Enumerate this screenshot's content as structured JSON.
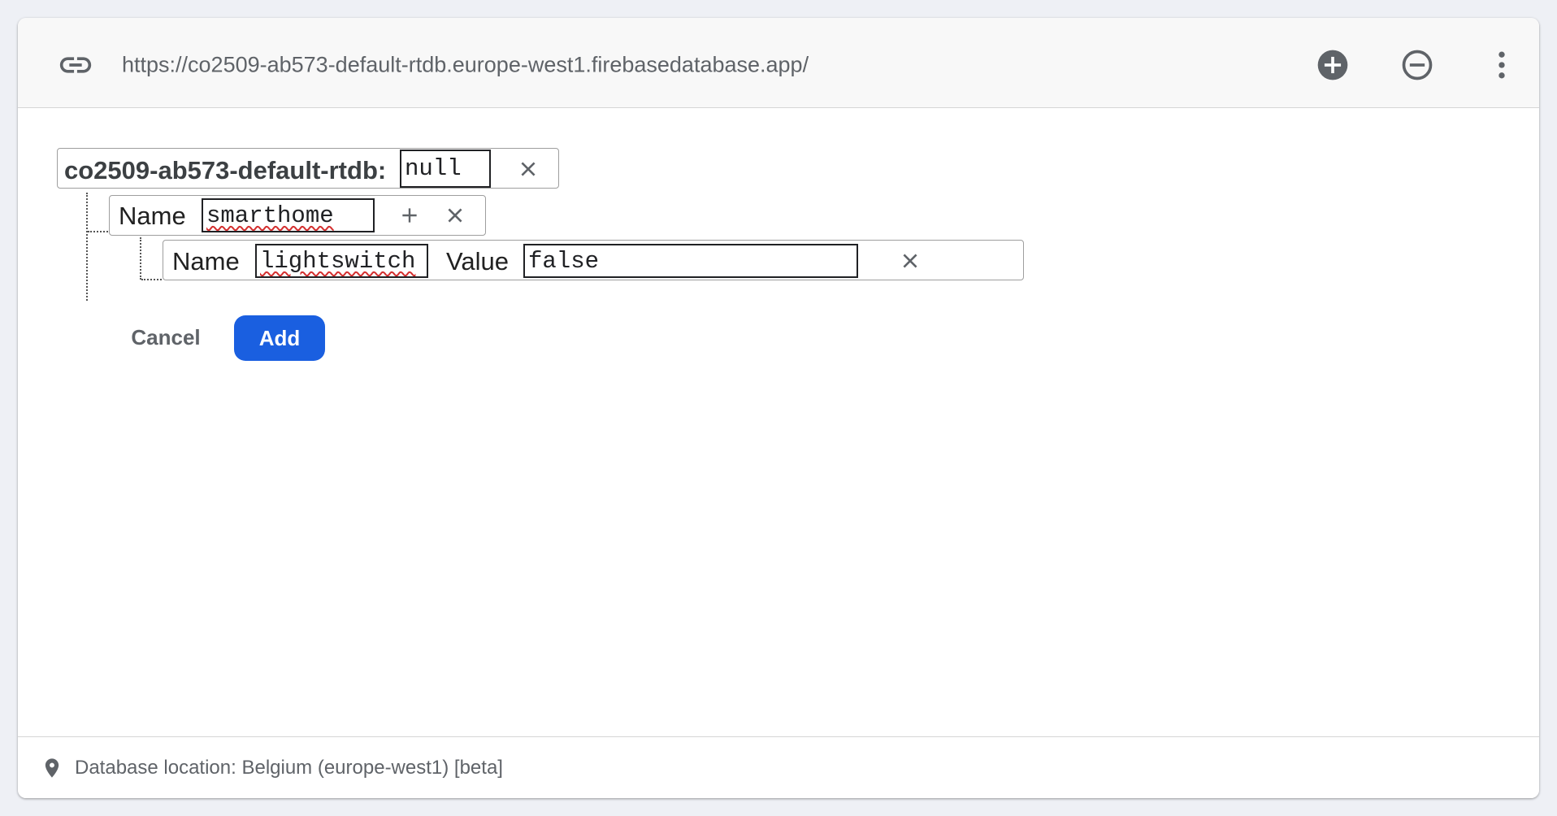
{
  "header": {
    "url": "https://co2509-ab573-default-rtdb.europe-west1.firebasedatabase.app/",
    "link_icon": "link-icon",
    "actions": [
      {
        "name": "add-circle-icon"
      },
      {
        "name": "remove-circle-icon"
      },
      {
        "name": "more-vert-icon"
      }
    ]
  },
  "tree": {
    "root": {
      "label": "co2509-ab573-default-rtdb:",
      "value": "null"
    },
    "child": {
      "name_label": "Name",
      "name_value": "smarthome"
    },
    "grandchild": {
      "name_label": "Name",
      "name_value": "lightswitch",
      "value_label": "Value",
      "value_value": "false"
    }
  },
  "actions": {
    "cancel_label": "Cancel",
    "add_label": "Add"
  },
  "footer": {
    "location_text": "Database location: Belgium (europe-west1) [beta]",
    "icon": "location-pin-icon"
  },
  "colors": {
    "primary": "#1a5fe0",
    "icon": "#5f6368",
    "background": "#eef0f5"
  }
}
